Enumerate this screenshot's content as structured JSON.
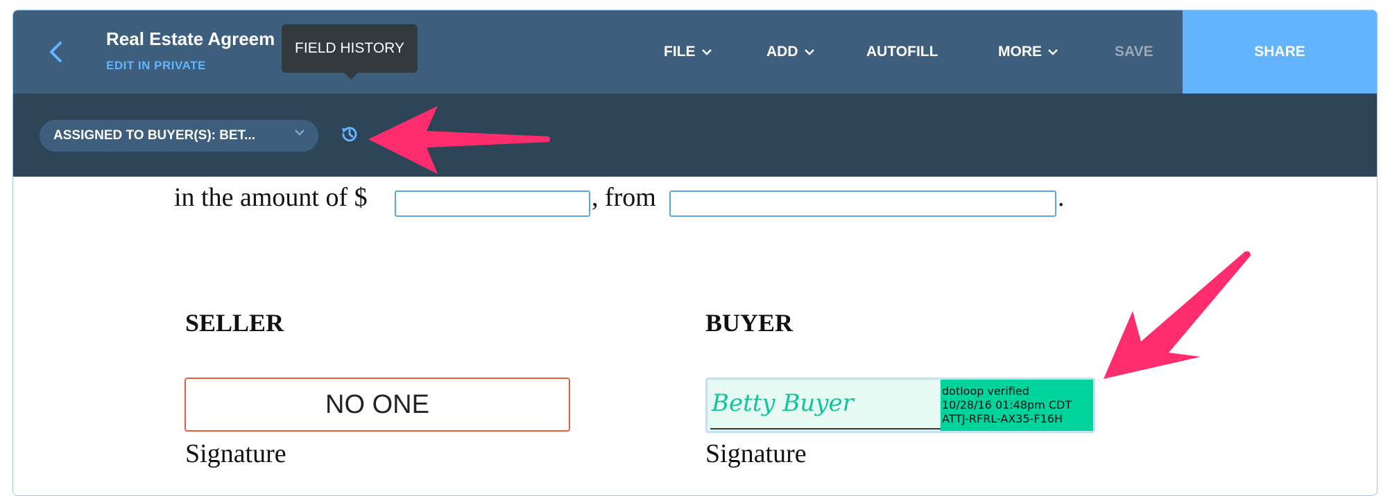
{
  "header": {
    "back_label": "",
    "title": "Real Estate Agreem",
    "subtitle": "EDIT IN PRIVATE",
    "tooltip": "FIELD HISTORY",
    "menu": {
      "file": "FILE",
      "add": "ADD",
      "autofill": "AUTOFILL",
      "more": "MORE",
      "save": "SAVE",
      "share": "SHARE"
    }
  },
  "subbar": {
    "assigned_label": "ASSIGNED TO BUYER(S): BET..."
  },
  "document": {
    "amount_prefix": "in the amount of $",
    "amount_value": "",
    "from_text": ", from",
    "from_value": "",
    "period": ".",
    "seller_heading": "SELLER",
    "buyer_heading": "BUYER",
    "seller_signature_value": "NO ONE",
    "seller_signature_label": "Signature",
    "buyer_signature_name": "Betty Buyer",
    "buyer_signature_label": "Signature",
    "verification": {
      "line1": "dotloop verified",
      "line2": "10/28/16 01:48pm CDT",
      "line3": "ATTJ-RFRL-AX35-F16H"
    }
  },
  "colors": {
    "header_bg": "#3d5f7d",
    "subbar_bg": "#2d4556",
    "share_bg": "#62b4ff",
    "accent_blue": "#62b4ff",
    "annotation_arrow": "#ff2d6e",
    "verified_green": "#00d49c",
    "signature_green": "#12c49a",
    "no_one_border": "#ef5b3e"
  },
  "icons": {
    "back": "chevron-left-icon",
    "history": "history-clock-icon",
    "dropdown": "chevron-down-icon"
  }
}
